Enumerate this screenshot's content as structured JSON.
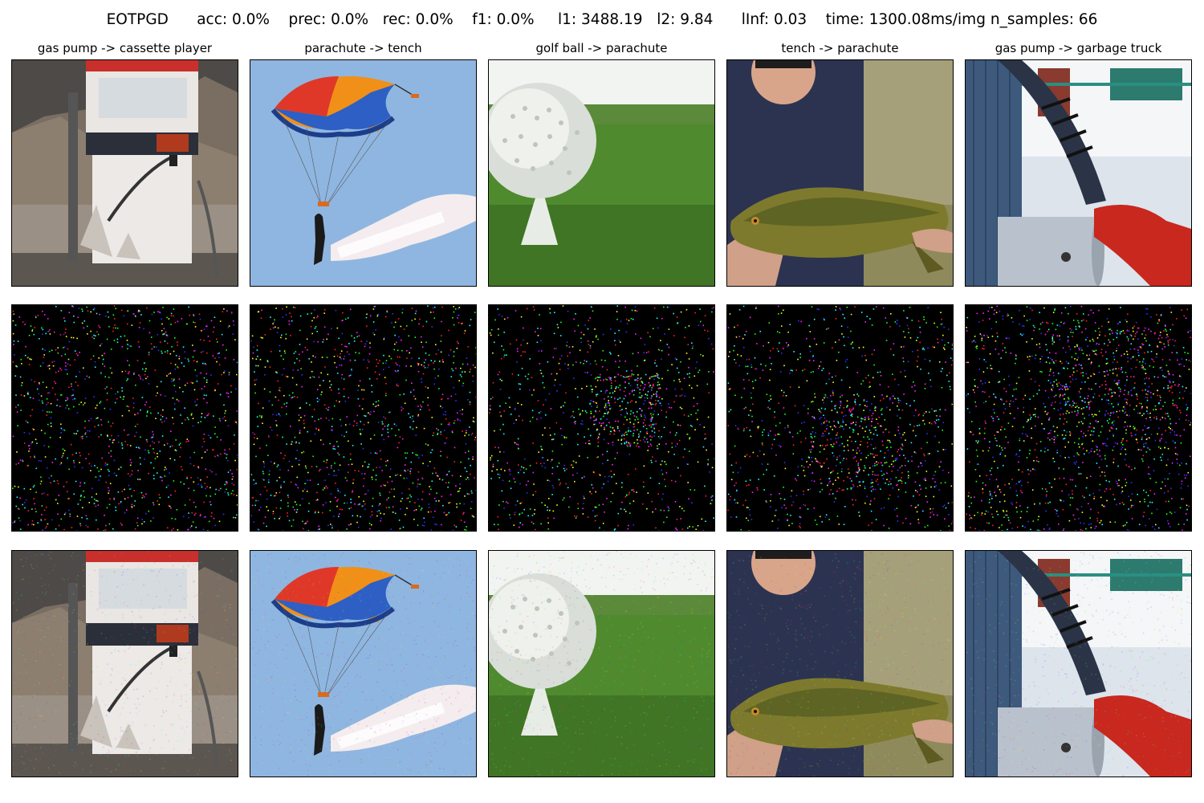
{
  "figure_title": {
    "method": "EOTPGD",
    "acc": "acc: 0.0%",
    "prec": "prec: 0.0%",
    "rec": "rec: 0.0%",
    "f1": "f1: 0.0%",
    "l1": "l1: 3488.19",
    "l2": "l2: 9.84",
    "linf": "lInf: 0.03",
    "time": "time: 1300.08ms/img",
    "n_samples": "n_samples: 66"
  },
  "columns": [
    {
      "title": "gas pump -> cassette player",
      "scene": "gas-pump"
    },
    {
      "title": "parachute -> tench",
      "scene": "parachute"
    },
    {
      "title": "golf ball -> parachute",
      "scene": "golf-ball"
    },
    {
      "title": "tench -> parachute",
      "scene": "tench"
    },
    {
      "title": "gas pump -> garbage truck",
      "scene": "gas-nozzle"
    }
  ],
  "rows": [
    "original-image",
    "perturbation",
    "adversarial-image"
  ],
  "noise_colors": [
    "#ff2020",
    "#20ff20",
    "#3030ff",
    "#ff20ff",
    "#20ffff",
    "#ffff20"
  ]
}
